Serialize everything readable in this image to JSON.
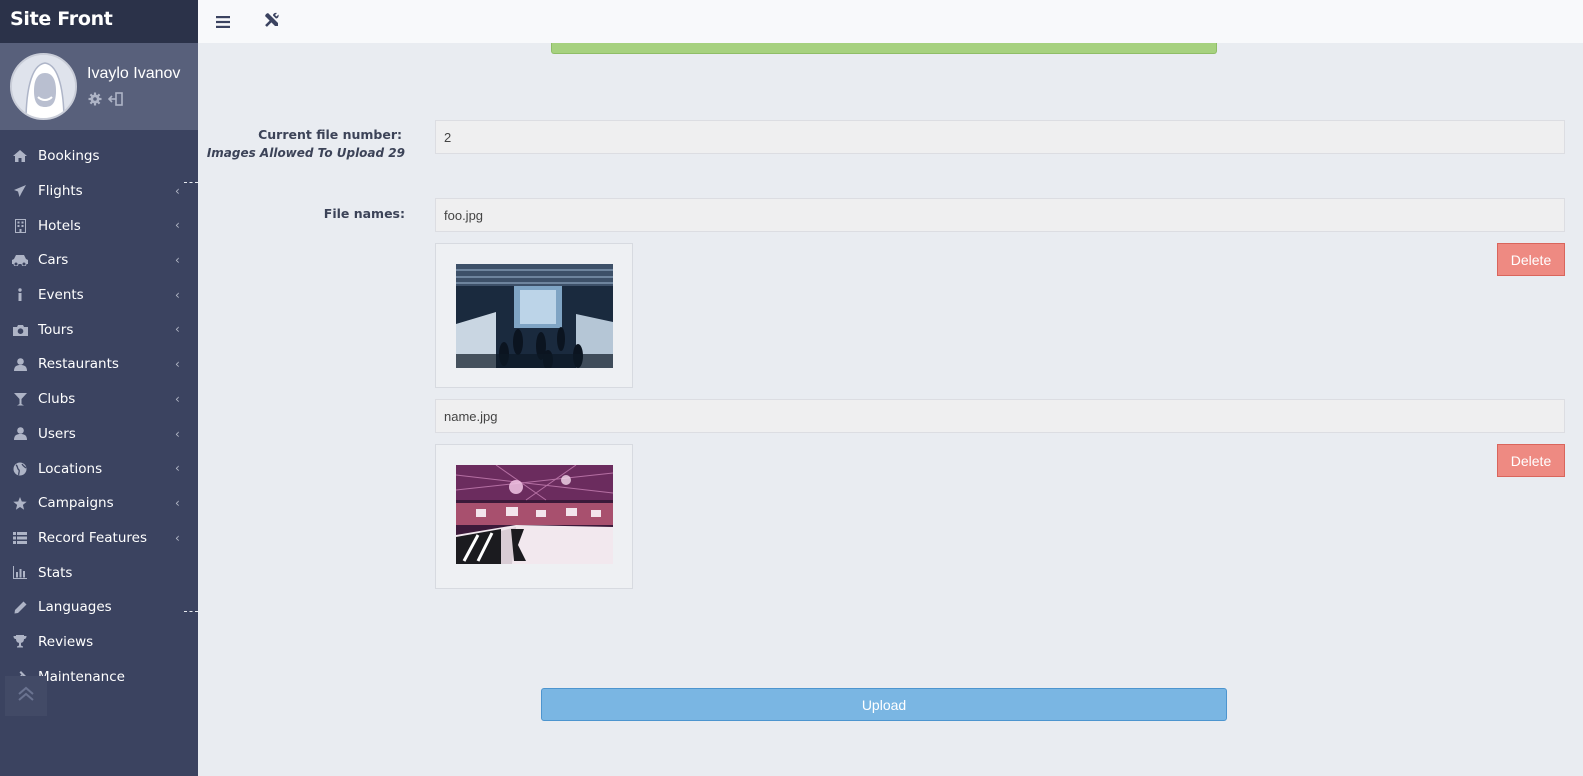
{
  "app": {
    "brand": "Site Front"
  },
  "user": {
    "name": "Ivaylo Ivanov"
  },
  "sidebar": {
    "items": [
      {
        "label": "Bookings",
        "icon": "home-icon",
        "has_children": false
      },
      {
        "label": "Flights",
        "icon": "plane-icon",
        "has_children": true
      },
      {
        "label": "Hotels",
        "icon": "building-icon",
        "has_children": true
      },
      {
        "label": "Cars",
        "icon": "car-icon",
        "has_children": true
      },
      {
        "label": "Events",
        "icon": "info-icon",
        "has_children": true
      },
      {
        "label": "Tours",
        "icon": "camera-icon",
        "has_children": true
      },
      {
        "label": "Restaurants",
        "icon": "user-icon",
        "has_children": true
      },
      {
        "label": "Clubs",
        "icon": "cocktail-icon",
        "has_children": true
      },
      {
        "label": "Users",
        "icon": "user-icon",
        "has_children": true
      },
      {
        "label": "Locations",
        "icon": "globe-icon",
        "has_children": true
      },
      {
        "label": "Campaigns",
        "icon": "star-icon",
        "has_children": true
      },
      {
        "label": "Record Features",
        "icon": "list-icon",
        "has_children": true
      },
      {
        "label": "Stats",
        "icon": "bar-chart-icon",
        "has_children": false
      },
      {
        "label": "Languages",
        "icon": "pencil-icon",
        "has_children": false
      },
      {
        "label": "Reviews",
        "icon": "trophy-icon",
        "has_children": false
      },
      {
        "label": "Maintenance",
        "icon": "hammer-icon",
        "has_children": false
      }
    ]
  },
  "form": {
    "current_file_label": "Current file number:",
    "allowed_label": "Images Allowed To Upload 29",
    "current_file_value": "2",
    "file_names_label": "File names:",
    "files": [
      {
        "name": "foo.jpg",
        "delete_label": "Delete"
      },
      {
        "name": "name.jpg",
        "delete_label": "Delete"
      }
    ],
    "upload_label": "Upload"
  },
  "colors": {
    "sidebar_bg": "#3b4360",
    "brand_bg": "#2b3249",
    "delete": "#ee8a82",
    "upload": "#7ab6e3",
    "success_bar": "#a6d17f"
  }
}
